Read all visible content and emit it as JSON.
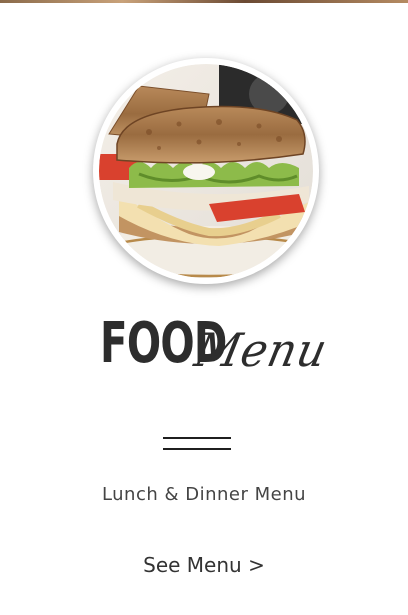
{
  "heading": {
    "bold_word": "FOOD",
    "script_word": "Menu"
  },
  "subtitle": "Lunch & Dinner Menu",
  "link": {
    "label": "See Menu >"
  },
  "photo": {
    "subject": "toasted club sandwich with turkey, lettuce, tomato and melted cheese"
  },
  "colors": {
    "text_dark": "#2d2d2d",
    "text_muted": "#444444",
    "background": "#ffffff"
  }
}
